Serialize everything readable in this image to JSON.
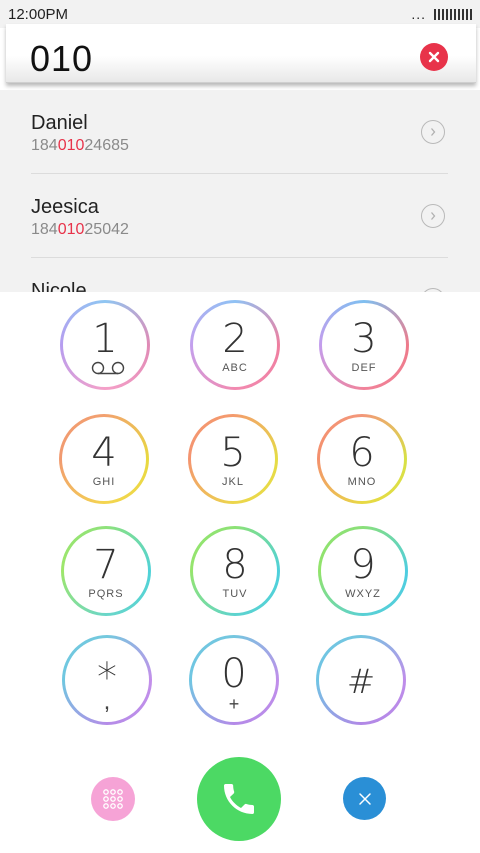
{
  "status_bar": {
    "time": "12:00PM",
    "dots": "..."
  },
  "search": {
    "query": "010"
  },
  "contacts": [
    {
      "name": "Daniel",
      "number_prefix": "184",
      "number_match": "010",
      "number_suffix": "24685"
    },
    {
      "name": "Jeesica",
      "number_prefix": "184",
      "number_match": "010",
      "number_suffix": "25042"
    },
    {
      "name": "Nicole",
      "number_prefix": "",
      "number_match": "",
      "number_suffix": ""
    }
  ],
  "keypad": {
    "keys": [
      {
        "digit": "1",
        "letters": ""
      },
      {
        "digit": "2",
        "letters": "ABC"
      },
      {
        "digit": "3",
        "letters": "DEF"
      },
      {
        "digit": "4",
        "letters": "GHI"
      },
      {
        "digit": "5",
        "letters": "JKL"
      },
      {
        "digit": "6",
        "letters": "MNO"
      },
      {
        "digit": "7",
        "letters": "PQRS"
      },
      {
        "digit": "8",
        "letters": "TUV"
      },
      {
        "digit": "9",
        "letters": "WXYZ"
      },
      {
        "digit": "*",
        "letters": ","
      },
      {
        "digit": "0",
        "letters": "+"
      },
      {
        "digit": "#",
        "letters": ""
      }
    ]
  },
  "colors": {
    "highlight": "#e8334a",
    "call_button": "#4cd964",
    "delete_button": "#2a8fd6",
    "dialpad_toggle": "#f6a3d6"
  },
  "icons": {
    "clear": "clear-icon",
    "chevron": "chevron-right-icon",
    "voicemail": "voicemail-icon",
    "dialpad": "dialpad-grid-icon",
    "call": "phone-icon",
    "delete": "close-icon"
  }
}
